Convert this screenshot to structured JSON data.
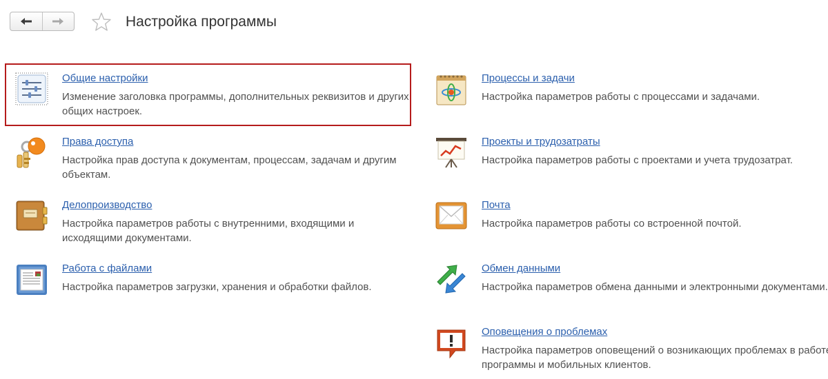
{
  "header": {
    "back_icon": "arrow-left-icon",
    "forward_icon": "arrow-right-icon",
    "favorite_icon": "star-outline-icon",
    "title": "Настройка программы"
  },
  "colors": {
    "link": "#2b5fad",
    "highlight_border": "#b51b1b"
  },
  "left_items": [
    {
      "title": "Общие настройки",
      "description": "Изменение заголовка программы, дополнительных реквизитов и других общих настроек.",
      "icon": "sliders-settings-icon",
      "selected": true
    },
    {
      "title": "Права доступа",
      "description": "Настройка прав доступа к документам, процессам, задачам и другим объектам.",
      "icon": "key-icon"
    },
    {
      "title": "Делопроизводство",
      "description": "Настройка параметров работы с внутренними, входящими и исходящими документами.",
      "icon": "folder-book-icon"
    },
    {
      "title": "Работа с файлами",
      "description": "Настройка параметров загрузки, хранения и обработки файлов.",
      "icon": "document-file-icon"
    }
  ],
  "right_items": [
    {
      "title": "Процессы и задачи",
      "description": "Настройка параметров работы с процессами и задачами.",
      "icon": "process-notepad-icon"
    },
    {
      "title": "Проекты и трудозатраты",
      "description": "Настройка параметров работы с проектами и учета трудозатрат.",
      "icon": "presentation-board-icon"
    },
    {
      "title": "Почта",
      "description": "Настройка параметров работы со встроенной почтой.",
      "icon": "envelope-icon"
    },
    {
      "title": "Обмен данными",
      "description": "Настройка параметров обмена данными и электронными документами.",
      "icon": "exchange-arrows-icon"
    },
    {
      "title": "Оповещения о проблемах",
      "description": "Настройка параметров оповещений о возникающих проблемах в работе программы и мобильных клиентов.",
      "icon": "alert-bubble-icon"
    }
  ]
}
